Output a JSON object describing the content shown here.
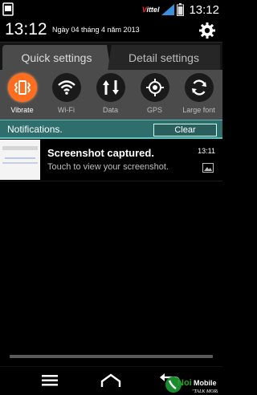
{
  "status_bar": {
    "carrier_prefix": "Viettel",
    "carrier_suffix": "",
    "time": "13:12"
  },
  "header": {
    "time": "13:12",
    "date": "Ngày 04 tháng 4 năm 2013"
  },
  "tabs": [
    {
      "label": "Quick settings",
      "active": true
    },
    {
      "label": "Detail settings",
      "active": false
    }
  ],
  "toggles": [
    {
      "label": "Vibrate",
      "icon": "vibrate-icon",
      "on": true
    },
    {
      "label": "Wi-Fi",
      "icon": "wifi-icon",
      "on": false
    },
    {
      "label": "Data",
      "icon": "data-icon",
      "on": false
    },
    {
      "label": "GPS",
      "icon": "gps-icon",
      "on": false
    },
    {
      "label": "Large font",
      "icon": "large-font-icon",
      "on": false
    }
  ],
  "notifications": {
    "title": "Notifications.",
    "clear_label": "Clear",
    "items": [
      {
        "title": "Screenshot captured.",
        "subtitle": "Touch to view your screenshot.",
        "time": "13:11"
      }
    ]
  },
  "colors": {
    "accent_orange": "#ff6e1f",
    "notif_teal": "#2e6e6d"
  }
}
